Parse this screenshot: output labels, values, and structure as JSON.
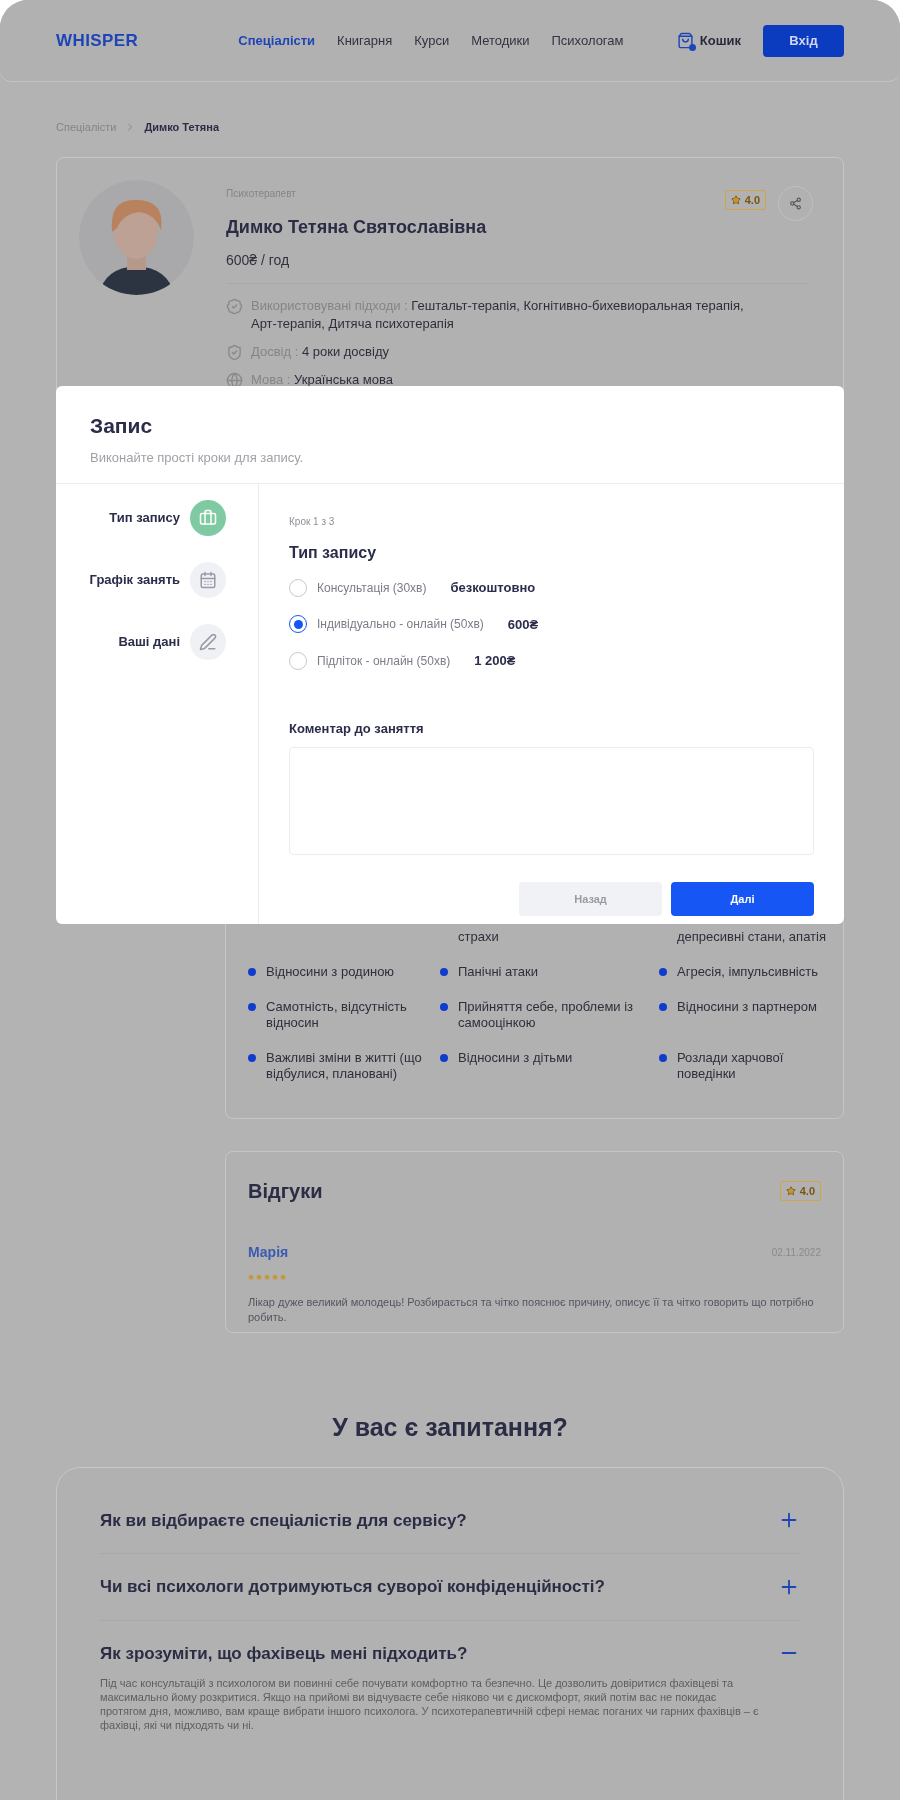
{
  "header": {
    "logo": "WHISPER",
    "nav": [
      {
        "label": "Спеціалісти",
        "selected": true
      },
      {
        "label": "Книгарня",
        "selected": false
      },
      {
        "label": "Курси",
        "selected": false
      },
      {
        "label": "Методики",
        "selected": false
      },
      {
        "label": "Психологам",
        "selected": false
      }
    ],
    "cart": "Кошик",
    "login": "Вхід"
  },
  "breadcrumb": [
    {
      "label": "Спеціалісти",
      "current": false
    },
    {
      "label": "Димко Тетяна",
      "current": true
    }
  ],
  "profile": {
    "role": "Психотерапевт",
    "name": "Димко Тетяна Святославівна",
    "price": "600₴ / год",
    "rating": "4.0",
    "details": [
      {
        "kind": "approach",
        "label": "Використовувані підходи :",
        "value": "Гештальт-терапія, Когнітивно-бихевиоральная терапія, Арт-терапія, Дитяча психотерапія"
      },
      {
        "kind": "experience",
        "label": "Досвід :",
        "value": "4 роки досвіду"
      },
      {
        "kind": "language",
        "label": "Мова :",
        "value": "Українська мова"
      }
    ]
  },
  "modal": {
    "title": "Запис",
    "subtitle": "Виконайте прості кроки для запису.",
    "steps": [
      {
        "kind": "type",
        "label": "Тип запису",
        "selected": true
      },
      {
        "kind": "schedule",
        "label": "Графік занять",
        "selected": false
      },
      {
        "kind": "data",
        "label": "Ваші дані",
        "selected": false
      }
    ],
    "step_counter": "Крок 1 з 3",
    "section_title": "Тип запису",
    "options": [
      {
        "label": "Консультація (30хв)",
        "price": "безкоштовно",
        "selected": false
      },
      {
        "label": "Індивідуально - онлайн (50хв)",
        "price": "600₴",
        "selected": true
      },
      {
        "label": "Підліток - онлайн (50хв)",
        "price": "1 200₴",
        "selected": false
      }
    ],
    "comment_label": "Коментар до заняття",
    "back": {
      "label": "Назад",
      "disabled": true
    },
    "next": {
      "label": "Далі",
      "disabled": false
    }
  },
  "topics": [
    {
      "kind": "cut"
    },
    {
      "kind": "cut",
      "text": "страхи"
    },
    {
      "kind": "cut",
      "text": "депресивні стани, апатія"
    },
    {
      "kind": "item",
      "text": "Відносини з родиною"
    },
    {
      "kind": "item",
      "text": "Панічні атаки"
    },
    {
      "kind": "item",
      "text": "Агресія, імпульсивність"
    },
    {
      "kind": "item",
      "text": "Самотність, відсутність відносин"
    },
    {
      "kind": "item",
      "text": "Прийняття себе, проблеми із самооцінкою"
    },
    {
      "kind": "item",
      "text": "Відносини з партнером"
    },
    {
      "kind": "item",
      "text": "Важливі зміни в житті (що відбулися, плановані)"
    },
    {
      "kind": "item",
      "text": "Відносини з дітьми"
    },
    {
      "kind": "item",
      "text": "Розлади харчової поведінки"
    }
  ],
  "reviews": {
    "title": "Відгуки",
    "rating": "4.0",
    "items": [
      {
        "author": "Марія",
        "stars": 5,
        "date": "02.11.2022",
        "text": "Лікар дуже великий молодець! Розбирається та чітко пояснює причину, описує її та чітко говорить що потрібно робить."
      }
    ]
  },
  "faq": {
    "title": "У вас є запитання?",
    "items": [
      {
        "question": "Як ви відбираєте спеціалістів для сервісу?",
        "expanded": false
      },
      {
        "question": "Чи всі психологи дотримуються суворої конфіденційності?",
        "expanded": false
      },
      {
        "question": "Як зрозуміти, що фахівець мені підходить?",
        "expanded": true,
        "answer": "Під час консультацій з психологом ви повинні себе почувати комфортно та безпечно. Це дозволить довіритися фахівцеві та максимально йому розкритися. Якщо на прийомі ви відчуваєте себе ніяково чи є дискомфорт, який потім вас не покидає протягом дня, можливо, вам краще вибрати іншого психолога. У психотерапевтичній сфері немає поганих чи гарних фахівців – є фахівці, які чи підходять чи ні."
      }
    ]
  }
}
